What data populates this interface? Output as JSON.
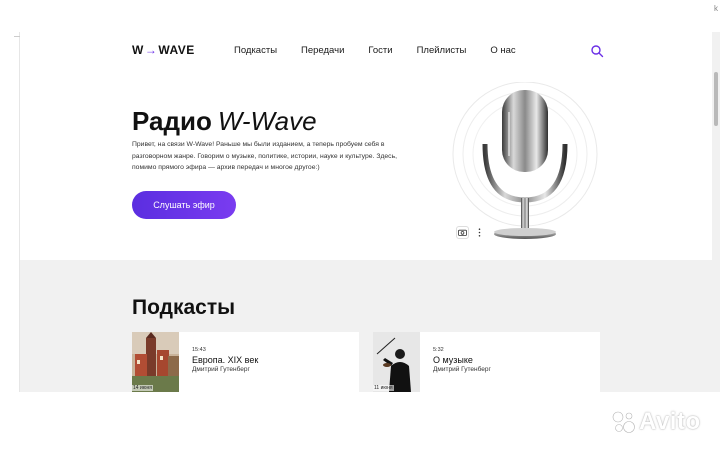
{
  "browser": {
    "corner_hint": "k"
  },
  "header": {
    "logo_left": "W",
    "logo_arrow": "→",
    "logo_right": "WAVE",
    "nav": [
      "Подкасты",
      "Передачи",
      "Гости",
      "Плейлисты",
      "О нас"
    ]
  },
  "hero": {
    "title_bold": "Радио",
    "title_italic": "W-Wave",
    "description": "Привет, на связи W-Wave! Раньше мы были изданием, а теперь пробуем себя в разговорном жанре. Говорим о музыке, политике, истории, науке и культуре. Здесь, помимо прямого эфира — архив передач и многое другое:)",
    "cta_label": "Слушать эфир"
  },
  "podcasts": {
    "title": "Подкасты",
    "cards": [
      {
        "duration": "15:43",
        "title": "Европа. XIX век",
        "author": "Дмитрий Гутенберг",
        "date": "14 июня"
      },
      {
        "duration": "5:32",
        "title": "О музыке",
        "author": "Дмитрий Гутенберг",
        "date": "11 июня"
      }
    ]
  },
  "watermark": {
    "text": "Avito"
  },
  "colors": {
    "accent": "#6a2ee6",
    "section_bg": "#f1f1f1"
  }
}
